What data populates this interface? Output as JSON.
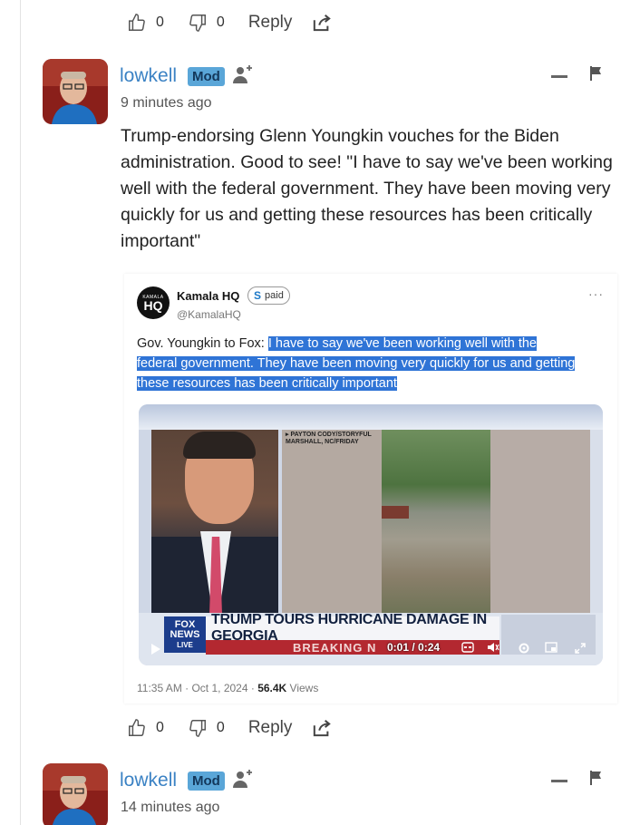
{
  "top_actions": {
    "like_count": "0",
    "dislike_count": "0",
    "reply_label": "Reply"
  },
  "comment1": {
    "author": "lowkell",
    "badge": "Mod",
    "time": "9 minutes ago",
    "body": "Trump-endorsing Glenn Youngkin vouches for the Biden administration. Good to see! \"I have to say we've been working well with the federal government. They have been moving very quickly for us and getting these resources has been critically important\"",
    "tweet": {
      "name": "Kamala HQ",
      "logo_small": "KAMALA",
      "logo_big": "HQ",
      "paid_symbol": "S",
      "paid_label": "paid",
      "handle": "@KamalaHQ",
      "more": "···",
      "text_lead": "Gov. Youngkin to Fox: ",
      "text_highlight": "I have to say we've been working well with the federal government. They have been moving very quickly for us and getting these resources has been critically important",
      "video": {
        "credit_line1": "▸ PAYTON CODY/STORYFUL",
        "credit_line2": "MARSHALL, NC/FRIDAY",
        "fox_line1": "FOX",
        "fox_line2": "NEWS",
        "fox_line3": "LIVE",
        "headline": "TRUMP TOURS HURRICANE DAMAGE IN GEORGIA",
        "breaking": "BREAKING N",
        "time": "0:01 / 0:24"
      },
      "footer_time": "11:35 AM · Oct 1, 2024 · ",
      "footer_views_count": "56.4K",
      "footer_views_label": " Views"
    },
    "actions": {
      "like_count": "0",
      "dislike_count": "0",
      "reply_label": "Reply"
    }
  },
  "comment2": {
    "author": "lowkell",
    "badge": "Mod",
    "time": "14 minutes ago"
  },
  "colors": {
    "link": "#3b82c4",
    "badge_bg": "#5aa6d8",
    "highlight": "#2f74d6"
  },
  "icons": [
    "thumbs-up-icon",
    "thumbs-down-icon",
    "share-icon",
    "follow-user-icon",
    "collapse-icon",
    "flag-icon"
  ]
}
